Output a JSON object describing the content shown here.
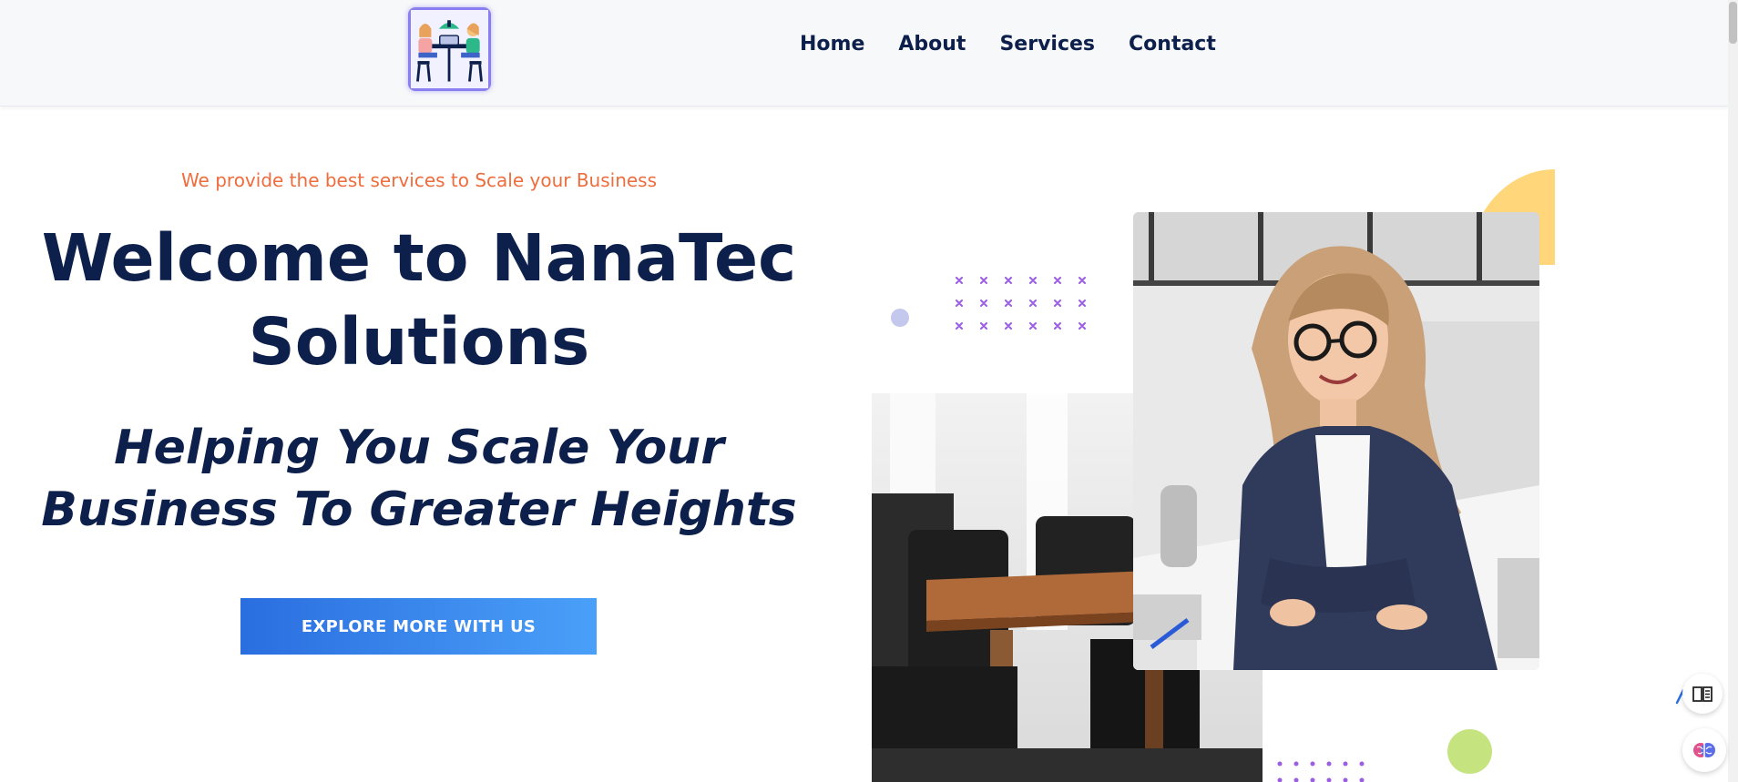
{
  "nav": {
    "logo_icon": "team-meeting-logo-icon",
    "links": [
      "Home",
      "About",
      "Services",
      "Contact"
    ]
  },
  "hero": {
    "tagline": "We provide the best services to Scale your Business",
    "title_line1": "Welcome to NanaTec",
    "title_line2": "Solutions",
    "subtitle_line1": "Helping You Scale Your",
    "subtitle_line2": "Business To Greater Heights",
    "cta_label": "EXPLORE MORE WITH US"
  },
  "images": {
    "office": "conference-room-photo",
    "woman": "smiling-woman-at-desk-photo"
  },
  "widgets": {
    "reader": "reader-mode-icon",
    "assistant": "brain-assistant-icon"
  },
  "colors": {
    "navy": "#0d1f4b",
    "accent_orange": "#ef6c3c",
    "cta_start": "#2a6ee0",
    "cta_end": "#4aa0f8",
    "deco_yellow": "#ffd67a",
    "deco_green": "#c5e37f",
    "deco_purple": "#9b5de5"
  }
}
